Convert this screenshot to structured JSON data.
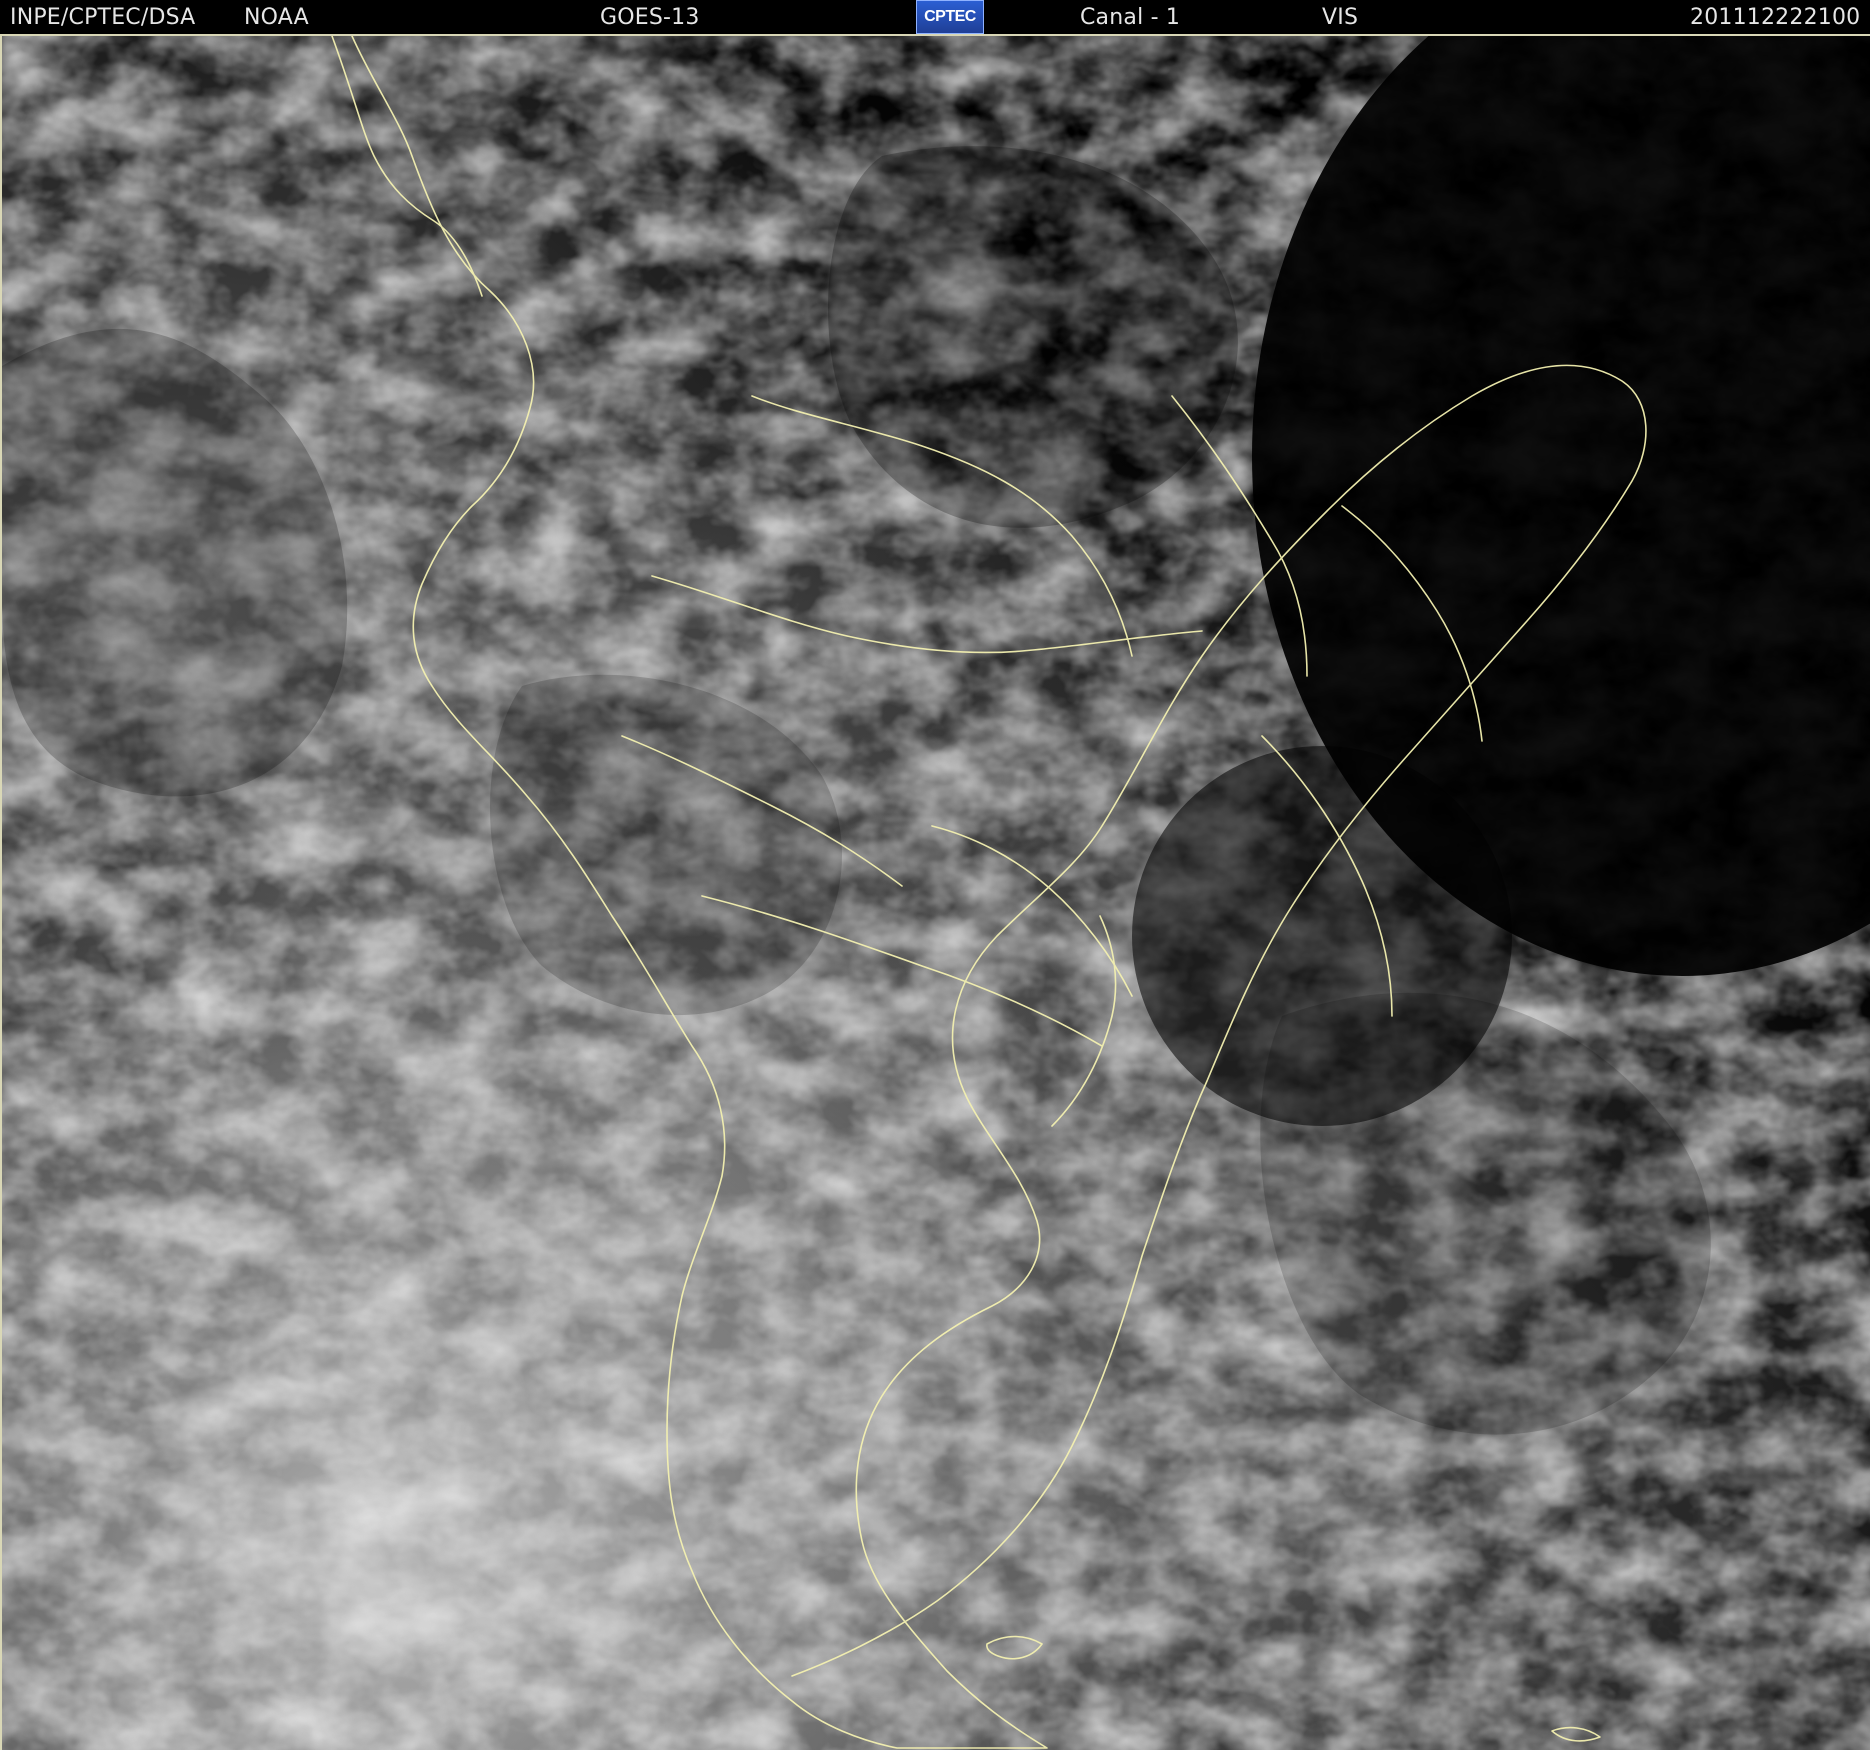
{
  "header": {
    "left_org": "INPE/CPTEC/DSA",
    "agency": "NOAA",
    "satellite": "GOES-13",
    "logo_text": "CPTEC",
    "channel": "Canal - 1",
    "band": "VIS",
    "timestamp": "201112222100"
  },
  "image": {
    "type": "satellite visible imagery",
    "colors": {
      "background": "#000000",
      "cloud_light": "#d8d8d8",
      "cloud_mid": "#8a8a8a",
      "coast_borders": "#f3f0b0"
    }
  }
}
